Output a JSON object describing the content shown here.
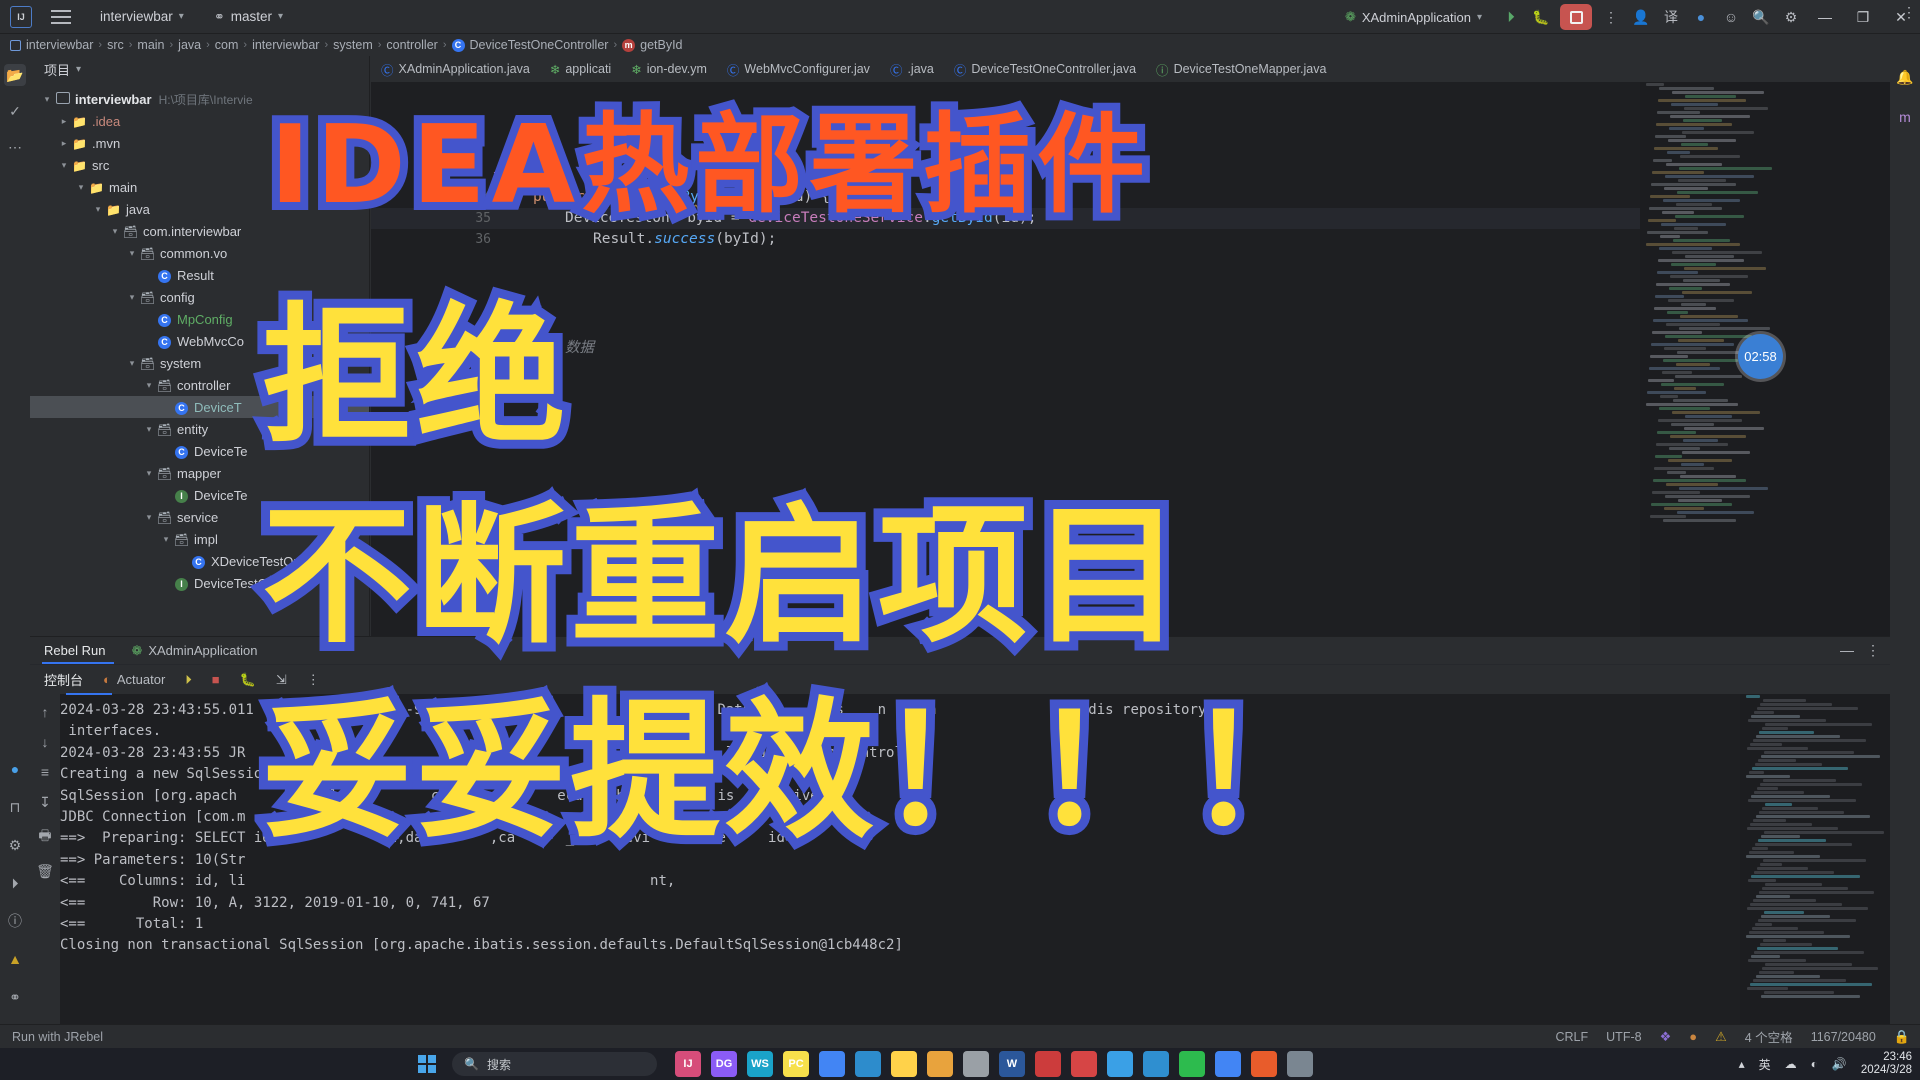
{
  "titlebar": {
    "logo": "IJ",
    "menu_icon": "hamburger-icon",
    "project": "interviewbar",
    "branch": "master",
    "branch_icon": "git-branch-icon",
    "run_config": "XAdminApplication",
    "run_icon": "run-icon",
    "debug_icon": "debug-icon",
    "stop_icon": "stop-icon",
    "more_icon": "more-vertical-icon",
    "add_user_icon": "add-user-icon",
    "translate_icon": "translate-icon",
    "updates_icon": "updates-icon",
    "feedback_icon": "feedback-icon",
    "search_icon": "search-icon",
    "settings_icon": "settings-icon",
    "minimize": "—",
    "maximize": "❐",
    "close": "✕"
  },
  "breadcrumb": {
    "items": [
      "interviewbar",
      "src",
      "main",
      "java",
      "com",
      "interviewbar",
      "system",
      "controller",
      "DeviceTestOneController",
      "getById"
    ],
    "separator": "›"
  },
  "project_panel": {
    "title": "项目",
    "tree": [
      {
        "depth": 0,
        "arrow": "v",
        "icon": "module",
        "label": "interviewbar",
        "bold": true,
        "path": "H:\\项目库\\Intervie"
      },
      {
        "depth": 1,
        "arrow": ">",
        "icon": "folder",
        "label": ".idea",
        "color": "red"
      },
      {
        "depth": 1,
        "arrow": ">",
        "icon": "folder",
        "label": ".mvn"
      },
      {
        "depth": 1,
        "arrow": "v",
        "icon": "folder",
        "label": "src"
      },
      {
        "depth": 2,
        "arrow": "v",
        "icon": "folder",
        "label": "main"
      },
      {
        "depth": 3,
        "arrow": "v",
        "icon": "folder-blue",
        "label": "java"
      },
      {
        "depth": 4,
        "arrow": "v",
        "icon": "package",
        "label": "com.interviewbar"
      },
      {
        "depth": 5,
        "arrow": "v",
        "icon": "package",
        "label": "common.vo"
      },
      {
        "depth": 6,
        "arrow": "",
        "icon": "class",
        "label": "Result"
      },
      {
        "depth": 5,
        "arrow": "v",
        "icon": "package",
        "label": "config"
      },
      {
        "depth": 6,
        "arrow": "",
        "icon": "class",
        "label": "MpConfig",
        "color": "green"
      },
      {
        "depth": 6,
        "arrow": "",
        "icon": "class",
        "label": "WebMvcCo"
      },
      {
        "depth": 5,
        "arrow": "v",
        "icon": "package",
        "label": "system"
      },
      {
        "depth": 6,
        "arrow": "v",
        "icon": "package",
        "label": "controller"
      },
      {
        "depth": 7,
        "arrow": "",
        "icon": "class",
        "label": "DeviceT",
        "selected": true,
        "color": "teal"
      },
      {
        "depth": 6,
        "arrow": "v",
        "icon": "package",
        "label": "entity"
      },
      {
        "depth": 7,
        "arrow": "",
        "icon": "class",
        "label": "DeviceTe"
      },
      {
        "depth": 6,
        "arrow": "v",
        "icon": "package",
        "label": "mapper"
      },
      {
        "depth": 7,
        "arrow": "",
        "icon": "interface",
        "label": "DeviceTe"
      },
      {
        "depth": 6,
        "arrow": "v",
        "icon": "package",
        "label": "service"
      },
      {
        "depth": 7,
        "arrow": "v",
        "icon": "package",
        "label": "impl"
      },
      {
        "depth": 8,
        "arrow": "",
        "icon": "class",
        "label": "XDeviceTestOn"
      },
      {
        "depth": 7,
        "arrow": "",
        "icon": "interface",
        "label": "DeviceTestOn"
      }
    ]
  },
  "editor_tabs": [
    {
      "label": "XAdminApplication.java",
      "icon": "java-class-icon"
    },
    {
      "label": "applicati",
      "icon": "yaml-icon"
    },
    {
      "label": "ion-dev.ym",
      "icon": "yaml-icon"
    },
    {
      "label": "WebMvcConfigurer.jav",
      "icon": "java-class-icon"
    },
    {
      "label": ".java",
      "icon": "java-class-icon"
    },
    {
      "label": "DeviceTestOneController.java",
      "icon": "java-class-icon"
    },
    {
      "label": "DeviceTestOneMapper.java",
      "icon": "java-interface-icon"
    }
  ],
  "editor": {
    "lines": [
      {
        "num": "",
        "text": "tMappi"
      },
      {
        "num": "34",
        "text": "    public Result getById(String id) {",
        "gutter_icon": "web-endpoint-icon"
      },
      {
        "num": "35",
        "text": "        DeviceTestOne byId = deviceTestOneService.getById(id);"
      },
      {
        "num": "36",
        "text": "        Result.success(byId);"
      }
    ],
    "comment_fragment": "数据"
  },
  "minimap": {
    "badge_time": "02:58"
  },
  "run_window": {
    "tabs": [
      {
        "label": "Rebel Run",
        "active": true
      },
      {
        "label": "XAdminApplication",
        "icon": "spring-boot-icon"
      }
    ],
    "console_bar": [
      {
        "label": "控制台",
        "active": true
      },
      {
        "label": "Actuator",
        "icon": "actuator-icon"
      }
    ],
    "toolbar_icons": [
      "rerun-icon",
      "stop-icon",
      "debug-icon",
      "export-icon",
      "more-vertical-icon"
    ],
    "minimize_icon": "minimize-icon",
    "more_icon": "more-vertical-icon",
    "gutter_icons": [
      "scroll-up-icon",
      "scroll-down-icon",
      "soft-wrap-icon",
      "scroll-end-icon",
      "print-icon",
      "trash-icon"
    ],
    "console_lines": [
      "2024-03-28 23:43:55.011  INFO      - [nio-99                                  Data r      y s    n    in                  dis repository",
      " interfaces.",
      "2024-03-28 23:43:55 JR           pr                                   n        ll  iceTestOneControll",
      "Creating a new SqlSession",
      "SqlSession [org.apach          ults.D       cb46           eca  nchronization is       ive",
      "JDBC Connection [com.m",
      "==>  Preparing: SELECT id,             u,date      ,ca      _id   devi      one     id=?",
      "==> Parameters: 10(Str",
      "<==    Columns: id, li                                                nt,",
      "<==        Row: 10, A, 3122, 2019-01-10, 0, 741, 67",
      "<==      Total: 1",
      "Closing non transactional SqlSession [org.apache.ibatis.session.defaults.DefaultSqlSession@1cb448c2]"
    ]
  },
  "status_bar": {
    "left": "Run with JRebel",
    "line_sep": "CRLF",
    "encoding": "UTF-8",
    "indent": "4 个空格",
    "memory": "1167/20480",
    "icons": [
      "jrebel-icon",
      "bell-icon",
      "warning-icon",
      "lock-icon"
    ]
  },
  "taskbar": {
    "start_icon": "windows-start-icon",
    "search_placeholder": "搜索",
    "search_icon": "search-icon",
    "apps": [
      {
        "name": "idea-app",
        "label": "IJ",
        "color": "#d64d7a"
      },
      {
        "name": "datagrip-app",
        "label": "DG",
        "color": "#8b5cf6"
      },
      {
        "name": "webstorm-app",
        "label": "WS",
        "color": "#1aa3c9"
      },
      {
        "name": "pycharm-app",
        "label": "PC",
        "color": "#f7e04b"
      },
      {
        "name": "chrome-app",
        "label": "",
        "color": "#4285f4"
      },
      {
        "name": "vscode-app",
        "label": "",
        "color": "#2d8ccc"
      },
      {
        "name": "explorer-app",
        "label": "",
        "color": "#ffd24a"
      },
      {
        "name": "navicat-app",
        "label": "",
        "color": "#e8a33d"
      },
      {
        "name": "terminal-app",
        "label": "",
        "color": "#9aa0a6"
      },
      {
        "name": "word-app",
        "label": "W",
        "color": "#2b579a"
      },
      {
        "name": "media-app",
        "label": "",
        "color": "#cc3c3c"
      },
      {
        "name": "opera-app",
        "label": "",
        "color": "#d64545"
      },
      {
        "name": "tim-app",
        "label": "",
        "color": "#3aa0e6"
      },
      {
        "name": "edge-app",
        "label": "",
        "color": "#2f8fd0"
      },
      {
        "name": "wechat-app",
        "label": "",
        "color": "#2dbb4e"
      },
      {
        "name": "chrome2-app",
        "label": "",
        "color": "#4285f4"
      },
      {
        "name": "qq-app",
        "label": "",
        "color": "#e85c2b"
      },
      {
        "name": "note-app",
        "label": "",
        "color": "#7a8691"
      }
    ],
    "tray": [
      "chevron-up-icon",
      "input-method-icon",
      "cloud-icon",
      "battery-icon",
      "network-icon",
      "volume-icon"
    ],
    "ime_label": "英",
    "clock_time": "23:46",
    "clock_date": "2024/3/28"
  },
  "overlay": {
    "title": "IDEA热部署插件",
    "line1": "拒绝",
    "line2": "不断重启项目",
    "line3": "妥妥提效！！！",
    "title_fill": "#ff5722",
    "title_stroke": "#4455cc",
    "body_fill": "#ffe13b",
    "body_stroke": "#4455cc"
  }
}
